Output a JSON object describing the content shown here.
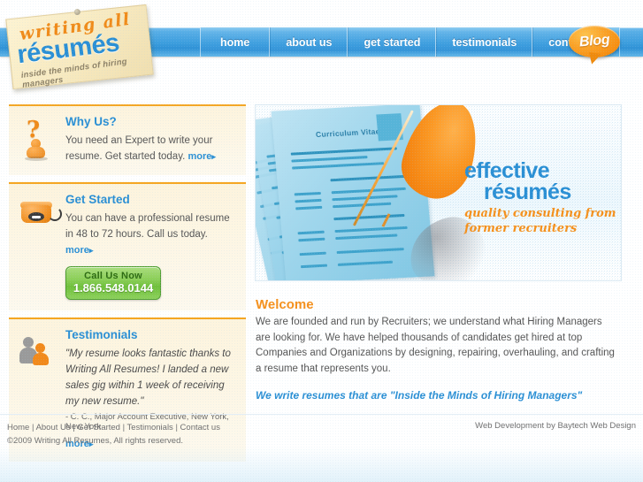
{
  "site": {
    "logo": {
      "line1": "writing all",
      "line2": "résumés",
      "tagline": "inside the minds of hiring managers"
    },
    "blog_badge": "Blog"
  },
  "nav": {
    "items": [
      {
        "label": "home"
      },
      {
        "label": "about us"
      },
      {
        "label": "get started"
      },
      {
        "label": "testimonials"
      },
      {
        "label": "contact us"
      }
    ]
  },
  "sidebar": {
    "why_us": {
      "icon": "question-person-icon",
      "title": "Why Us?",
      "text": "You need an Expert to write your resume.  Get started today.",
      "more": "more",
      "caret": "▸"
    },
    "get_started": {
      "icon": "telephone-icon",
      "title": "Get Started",
      "text": "You can have a professional resume in 48 to 72 hours. Call us today.",
      "more": "more",
      "caret": "▸",
      "call_button": {
        "label": "Call Us Now",
        "phone": "1.866.548.0144"
      }
    },
    "testimonials": {
      "icon": "two-people-icon",
      "title": "Testimonials",
      "quote": "\"My resume looks fantastic thanks to Writing All Resumes! I landed a new sales gig within 1 week of receiving my new resume.\"",
      "attribution": "- C. C., Major Account Executive, New York, New York",
      "more": "more",
      "caret": "▸"
    }
  },
  "hero": {
    "document_label": "Curriculum Vitae",
    "headline_line1": "effective",
    "headline_line2": "résumés",
    "subline": "quality consulting from former recruiters"
  },
  "main": {
    "welcome_title": "Welcome",
    "welcome_body": "We are founded and run by Recruiters; we understand what Hiring Managers are looking for. We have helped thousands of candidates get hired at top Companies and Organizations by designing, repairing, overhauling, and crafting a resume that represents you.",
    "welcome_tagline": "We write resumes that are \"Inside the Minds of Hiring Managers\""
  },
  "footer": {
    "links": "Home | About Us | Get Started | Testimonials | Contact us",
    "copyright": "©2009 Writing All Resumes, All rights reserved.",
    "credit": "Web Development by Baytech Web Design"
  },
  "colors": {
    "brand_blue": "#2a8fd4",
    "brand_orange": "#f5901b",
    "cream": "#fdf4dd",
    "green_button": "#6fc03a"
  }
}
